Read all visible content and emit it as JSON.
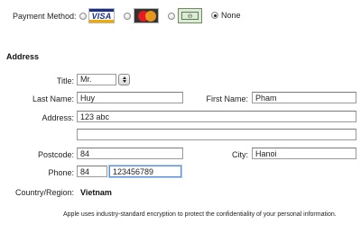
{
  "payment": {
    "label": "Payment Method:",
    "options": [
      {
        "card": "VISA",
        "selected": false
      },
      {
        "card": "MasterCard",
        "selected": false
      },
      {
        "card": "American Express",
        "selected": false
      },
      {
        "card": "None",
        "selected": true
      }
    ],
    "none_label": "None"
  },
  "address": {
    "section_title": "Address",
    "title_label": "Title:",
    "title_value": "Mr.",
    "last_name_label": "Last Name:",
    "last_name_value": "Huy",
    "first_name_label": "First Name:",
    "first_name_value": "Pham",
    "address_label": "Address:",
    "address_line1": "123 abc",
    "address_line2": "",
    "postcode_label": "Postcode:",
    "postcode_value": "84",
    "city_label": "City:",
    "city_value": "Hanoi",
    "phone_label": "Phone:",
    "phone_area": "84",
    "phone_number": "123456789",
    "country_label": "Country/Region:",
    "country_value": "Vietnam"
  },
  "footer": {
    "note": "Apple uses industry-standard encryption to protect the confidentiality of your personal information."
  },
  "colors": {
    "focus_border": "#5b8fd6",
    "visa_blue": "#1a2f8a",
    "visa_gold": "#f2a900"
  }
}
